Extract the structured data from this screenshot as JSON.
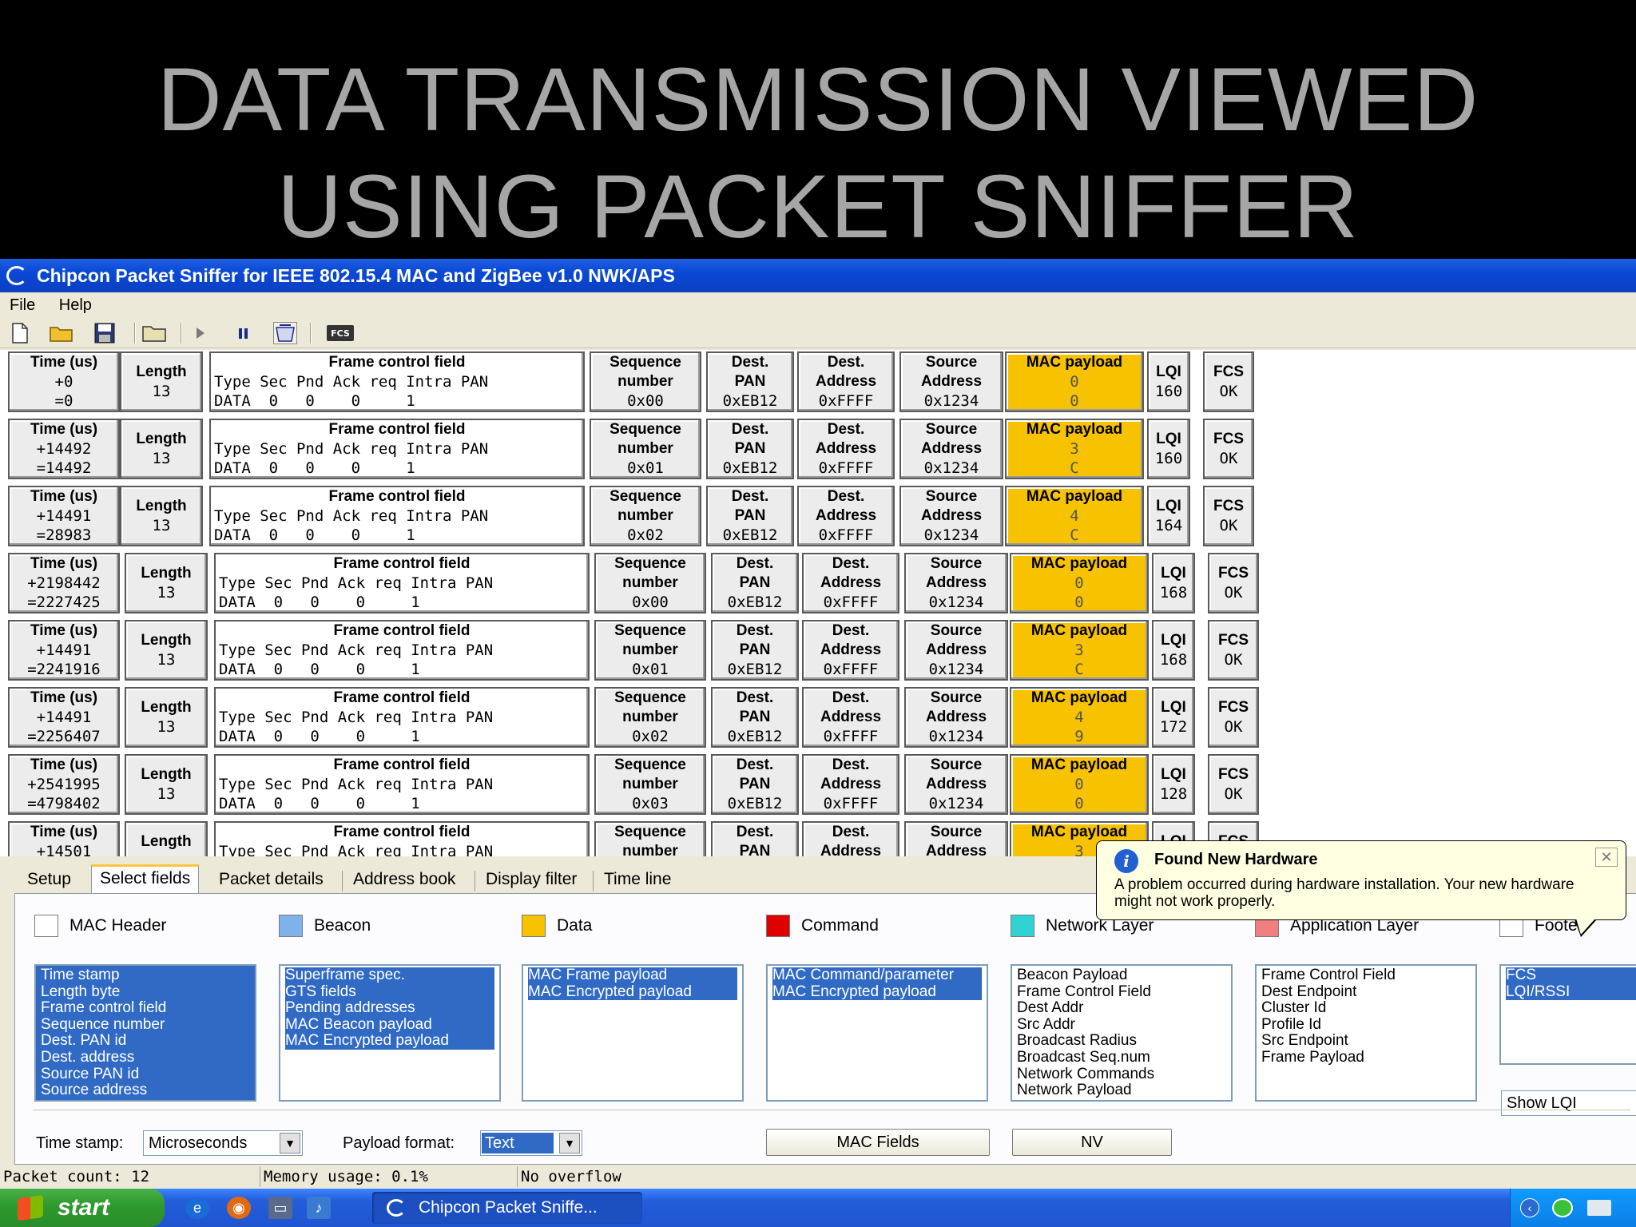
{
  "slide_title": [
    "DATA TRANSMISSION VIEWED",
    "USING  PACKET SNIFFER"
  ],
  "window": {
    "title": "Chipcon Packet Sniffer for IEEE 802.15.4 MAC and ZigBee v1.0 NWK/APS",
    "menu": [
      "File",
      "Help"
    ],
    "toolbar_icons": [
      "new-file-icon",
      "open-folder-icon",
      "save-icon",
      "folder-icon",
      "play-icon",
      "pause-icon",
      "clear-icon",
      "fcs-icon"
    ],
    "toolbar_fcs_label": "FCS"
  },
  "packet_headers": {
    "time": "Time (us)",
    "length": "Length",
    "fcf": "Frame control field",
    "fcf_sub": "Type Sec Pnd Ack req Intra PAN",
    "seq": [
      "Sequence",
      "number"
    ],
    "dest_pan": [
      "Dest.",
      "PAN"
    ],
    "dest_addr": [
      "Dest.",
      "Address"
    ],
    "src_addr": [
      "Source",
      "Address"
    ],
    "payload": "MAC payload",
    "lqi": "LQI",
    "fcs": "FCS"
  },
  "packets": [
    {
      "time_delta": "+0",
      "time_abs": "=0",
      "length": "13",
      "fcf_values": "DATA  0   0    0     1",
      "seq": "0x00",
      "dest_pan": "0xEB12",
      "dest_addr": "0xFFFF",
      "src_addr": "0x1234",
      "payload": [
        "0",
        "0"
      ],
      "lqi": "160",
      "fcs": "OK"
    },
    {
      "time_delta": "+14492",
      "time_abs": "=14492",
      "length": "13",
      "fcf_values": "DATA  0   0    0     1",
      "seq": "0x01",
      "dest_pan": "0xEB12",
      "dest_addr": "0xFFFF",
      "src_addr": "0x1234",
      "payload": [
        "3",
        "C"
      ],
      "lqi": "160",
      "fcs": "OK"
    },
    {
      "time_delta": "+14491",
      "time_abs": "=28983",
      "length": "13",
      "fcf_values": "DATA  0   0    0     1",
      "seq": "0x02",
      "dest_pan": "0xEB12",
      "dest_addr": "0xFFFF",
      "src_addr": "0x1234",
      "payload": [
        "4",
        "C"
      ],
      "lqi": "164",
      "fcs": "OK"
    },
    {
      "time_delta": "+2198442",
      "time_abs": "=2227425",
      "length": "13",
      "fcf_values": "DATA  0   0    0     1",
      "seq": "0x00",
      "dest_pan": "0xEB12",
      "dest_addr": "0xFFFF",
      "src_addr": "0x1234",
      "payload": [
        "0",
        "0"
      ],
      "lqi": "168",
      "fcs": "OK"
    },
    {
      "time_delta": "+14491",
      "time_abs": "=2241916",
      "length": "13",
      "fcf_values": "DATA  0   0    0     1",
      "seq": "0x01",
      "dest_pan": "0xEB12",
      "dest_addr": "0xFFFF",
      "src_addr": "0x1234",
      "payload": [
        "3",
        "C"
      ],
      "lqi": "168",
      "fcs": "OK"
    },
    {
      "time_delta": "+14491",
      "time_abs": "=2256407",
      "length": "13",
      "fcf_values": "DATA  0   0    0     1",
      "seq": "0x02",
      "dest_pan": "0xEB12",
      "dest_addr": "0xFFFF",
      "src_addr": "0x1234",
      "payload": [
        "4",
        "9"
      ],
      "lqi": "172",
      "fcs": "OK"
    },
    {
      "time_delta": "+2541995",
      "time_abs": "=4798402",
      "length": "13",
      "fcf_values": "DATA  0   0    0     1",
      "seq": "0x03",
      "dest_pan": "0xEB12",
      "dest_addr": "0xFFFF",
      "src_addr": "0x1234",
      "payload": [
        "0",
        "0"
      ],
      "lqi": "128",
      "fcs": "OK"
    },
    {
      "time_delta": "+14501",
      "time_abs": "",
      "length": "",
      "fcf_values": "",
      "seq": "",
      "dest_pan": "",
      "dest_addr": "",
      "src_addr": "",
      "payload": [
        "3",
        ""
      ],
      "lqi": "",
      "fcs": ""
    }
  ],
  "tabs": [
    "Setup",
    "Select fields",
    "Packet details",
    "Address book",
    "Display filter",
    "Time line"
  ],
  "active_tab": "Select fields",
  "field_groups": [
    {
      "label": "MAC Header",
      "color": "#ffffff",
      "items": [
        "Time stamp",
        "Length byte",
        "Frame control field",
        "Sequence number",
        "Dest. PAN id",
        "Dest. address",
        "Source PAN id",
        "Source address"
      ],
      "selected_all": true
    },
    {
      "label": "Beacon",
      "color": "#7fb2ea",
      "items": [
        "Superframe spec.",
        "GTS fields",
        "Pending addresses",
        "MAC Beacon payload",
        "MAC Encrypted payload"
      ],
      "selected_all": true
    },
    {
      "label": "Data",
      "color": "#f7c200",
      "items": [
        "MAC Frame payload",
        "MAC Encrypted payload"
      ],
      "selected_all": true
    },
    {
      "label": "Command",
      "color": "#e00000",
      "items": [
        "MAC Command/parameter",
        "MAC Encrypted payload"
      ],
      "selected_all": true
    },
    {
      "label": "Network Layer",
      "color": "#2fd3d3",
      "items": [
        "Beacon Payload",
        "Frame Control Field",
        "Dest Addr",
        "Src Addr",
        "Broadcast Radius",
        "Broadcast Seq.num",
        "Network Commands",
        "Network Payload"
      ],
      "selected_all": false
    },
    {
      "label": "Application Layer",
      "color": "#f08080",
      "items": [
        "Frame Control Field",
        "Dest Endpoint",
        "Cluster Id",
        "Profile Id",
        "Src Endpoint",
        "Frame Payload"
      ],
      "selected_all": false
    },
    {
      "label": "Footer",
      "color": "#ffffff",
      "items": [
        "FCS",
        "LQI/RSSI"
      ],
      "selected_all": true
    }
  ],
  "show_lqi": "Show LQI",
  "timestamp_label": "Time stamp:",
  "timestamp_value": "Microseconds",
  "payload_format_label": "Payload format:",
  "payload_format_value": "Text",
  "mac_fields_button": "MAC Fields",
  "nwk_fields_button": "NV",
  "status": {
    "packet_count": "Packet count: 12",
    "memory": "Memory usage: 0.1%",
    "overflow": "No overflow"
  },
  "taskbar": {
    "start": "start",
    "task_button": "Chipcon Packet Sniffe..."
  },
  "balloon": {
    "title": "Found New Hardware",
    "message": "A problem occurred during hardware installation. Your new hardware might not work properly.",
    "close": "✕"
  }
}
